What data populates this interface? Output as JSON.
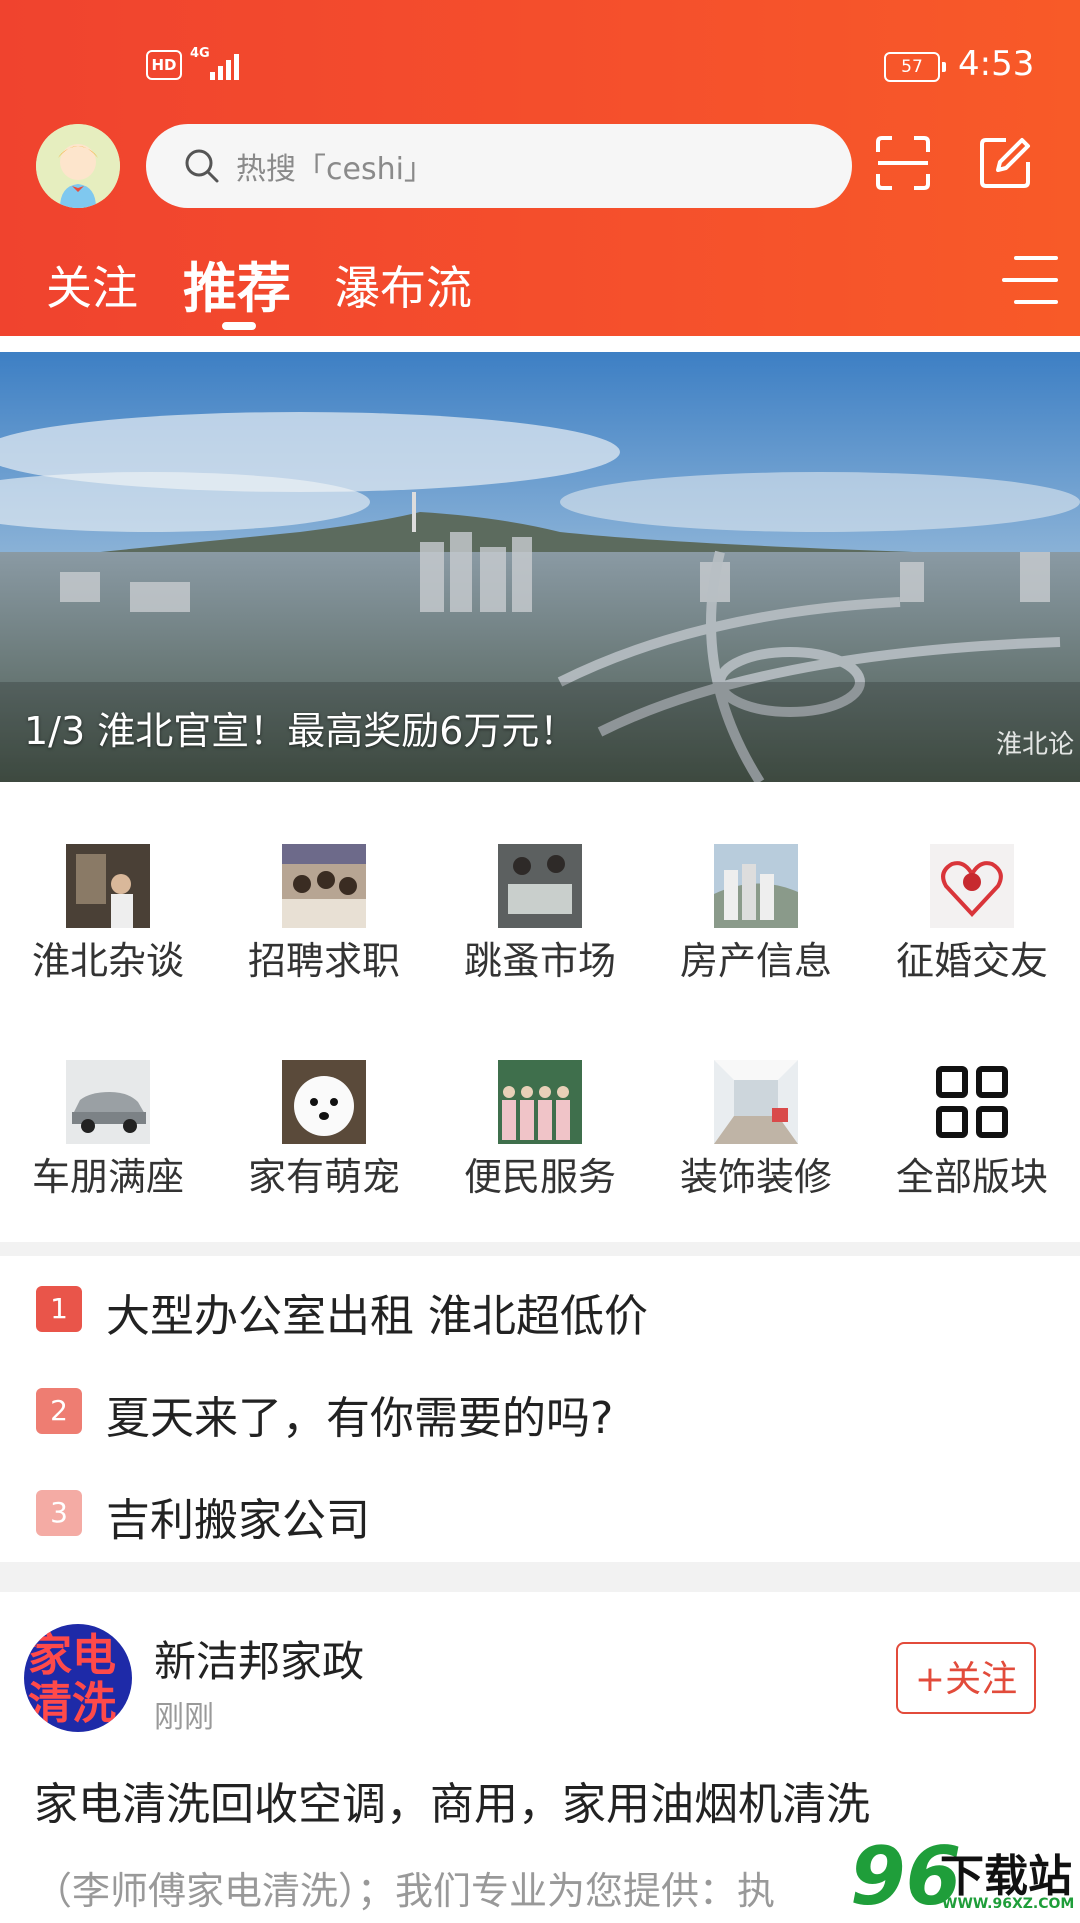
{
  "status_bar": {
    "hd": "HD",
    "network": "4G",
    "battery": "57",
    "time": "4:53"
  },
  "header": {
    "search_placeholder": "热搜「ceshi」",
    "tabs": [
      {
        "label": "关注",
        "active": false
      },
      {
        "label": "推荐",
        "active": true
      },
      {
        "label": "瀑布流",
        "active": false
      }
    ],
    "icons": [
      "avatar",
      "search-icon",
      "scan-icon",
      "edit-icon",
      "menu-icon"
    ]
  },
  "banner": {
    "caption": "1/3 淮北官宣！最高奖励6万元！",
    "watermark": "淮北论"
  },
  "categories": [
    {
      "label": "淮北杂谈",
      "icon": "thumb-street"
    },
    {
      "label": "招聘求职",
      "icon": "thumb-crowd"
    },
    {
      "label": "跳蚤市场",
      "icon": "thumb-market"
    },
    {
      "label": "房产信息",
      "icon": "thumb-buildings"
    },
    {
      "label": "征婚交友",
      "icon": "thumb-heart"
    },
    {
      "label": "车朋满座",
      "icon": "thumb-car"
    },
    {
      "label": "家有萌宠",
      "icon": "thumb-dog"
    },
    {
      "label": "便民服务",
      "icon": "thumb-staff"
    },
    {
      "label": "装饰装修",
      "icon": "thumb-interior"
    },
    {
      "label": "全部版块",
      "icon": "grid-icon"
    }
  ],
  "hot_list": [
    {
      "rank": "1",
      "text": "大型办公室出租 淮北超低价",
      "color": "#e9554a"
    },
    {
      "rank": "2",
      "text": "夏天来了，有你需要的吗?",
      "color": "#ee7d72"
    },
    {
      "rank": "3",
      "text": "吉利搬家公司",
      "color": "#f4aba4"
    }
  ],
  "post": {
    "avatar_text": [
      "家电",
      "清洗"
    ],
    "author": "新洁邦家政",
    "time": "刚刚",
    "follow_label": "+关注",
    "title": "家电清洗回收空调，商用，家用油烟机清洗",
    "snippet": "（李师傅家电清洗）；我们专业为您提供：执"
  },
  "site_logo": {
    "number": "96",
    "text": "下载站",
    "url": "WWW.96XZ.COM"
  },
  "colors": {
    "brand": "#f24a2c",
    "follow": "#e24b3b"
  }
}
